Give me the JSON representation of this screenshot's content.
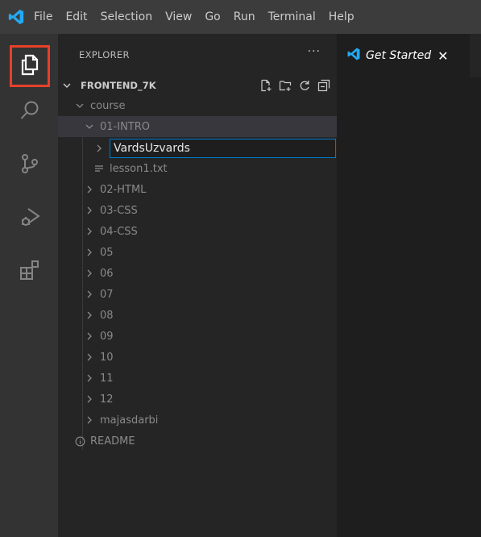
{
  "menu": [
    "File",
    "Edit",
    "Selection",
    "View",
    "Go",
    "Run",
    "Terminal",
    "Help"
  ],
  "sidebar": {
    "title": "EXPLORER",
    "more": "···",
    "section": "FRONTEND_7K"
  },
  "tree": {
    "course": "course",
    "intro": "01-INTRO",
    "input_value": "VardsUzvards",
    "lesson": "lesson1.txt",
    "html": "02-HTML",
    "css3": "03-CSS",
    "css4": "04-CSS",
    "f05": "05",
    "f06": "06",
    "f07": "07",
    "f08": "08",
    "f09": "09",
    "f10": "10",
    "f11": "11",
    "f12": "12",
    "majasdarbi": "majasdarbi",
    "readme": "README"
  },
  "editor": {
    "tab_label": "Get Started"
  },
  "colors": {
    "accent": "#007acc",
    "highlight_box": "#e8402a",
    "logo_blue": "#23a8f2"
  }
}
